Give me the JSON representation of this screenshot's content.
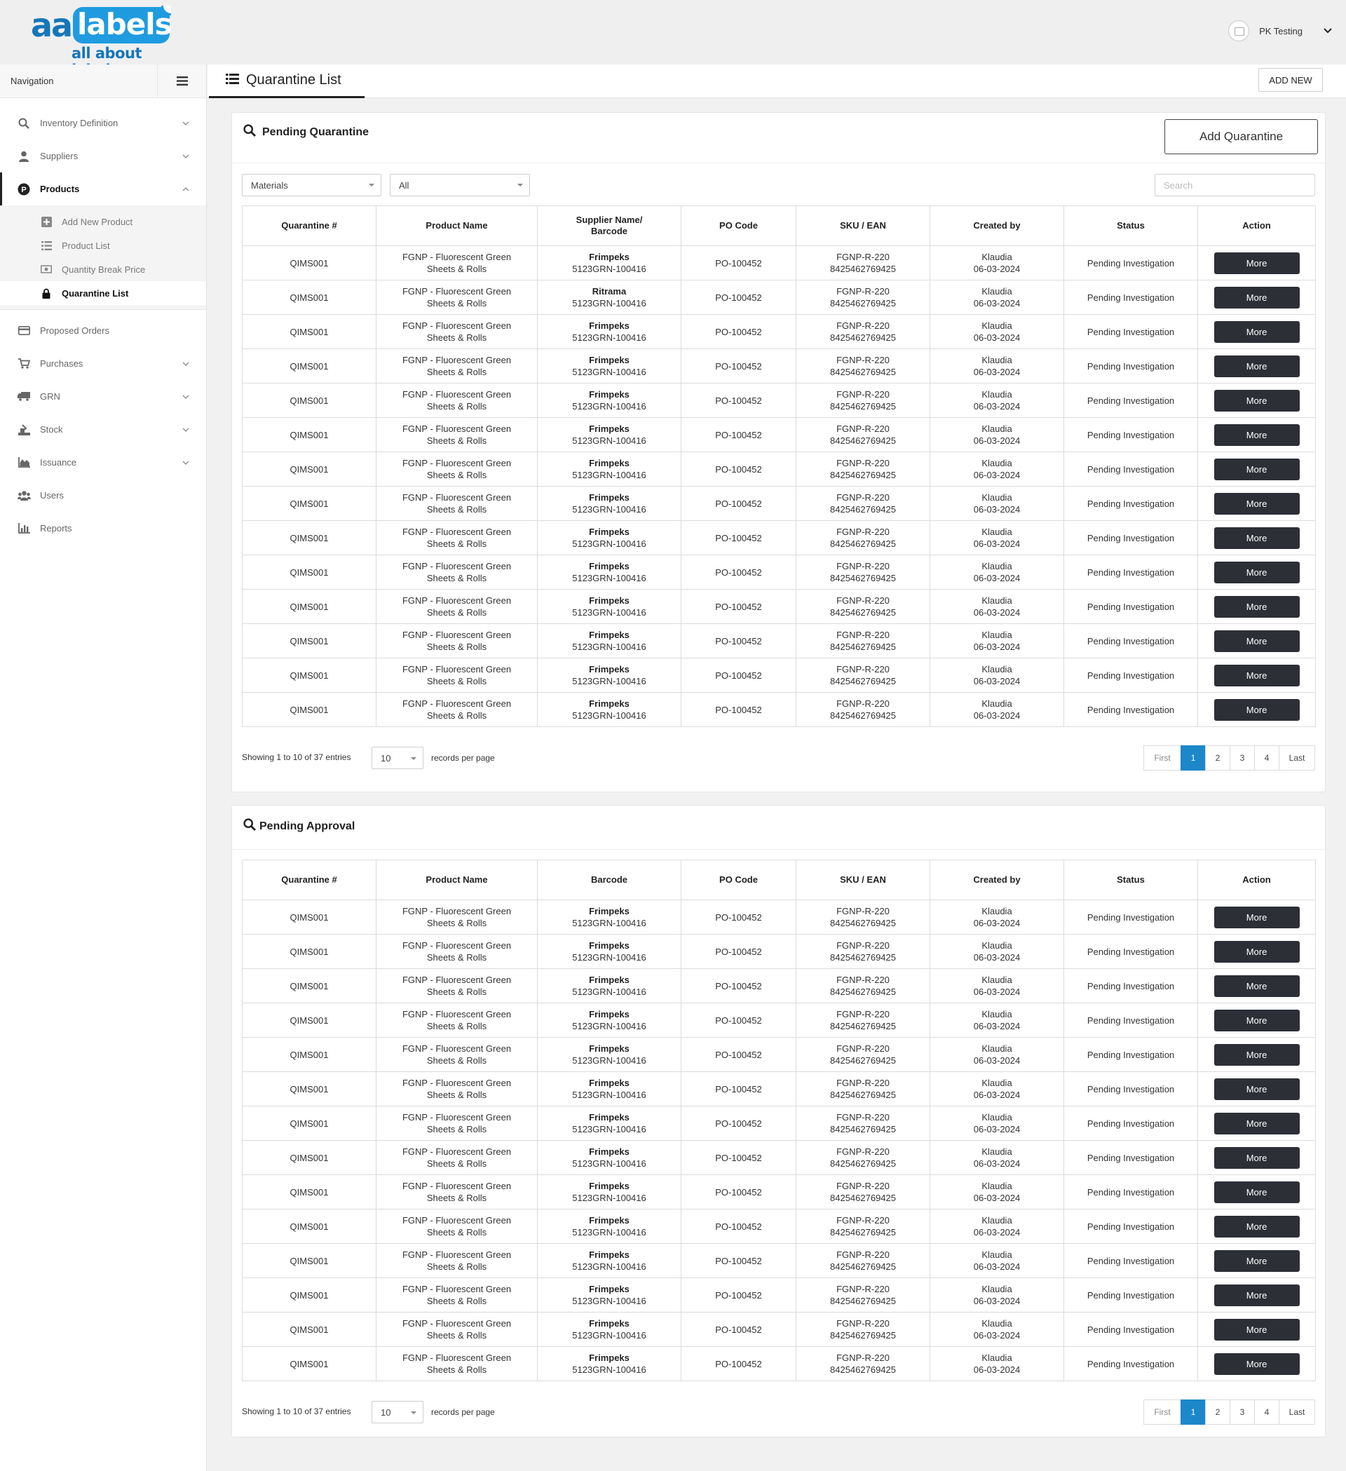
{
  "brand": {
    "logo_aa": "aa",
    "logo_labels": "labels",
    "logo_tagline": "all about labels"
  },
  "user": {
    "name": "PK Testing"
  },
  "sidebar": {
    "header": "Navigation",
    "items": [
      {
        "label": "Inventory Definition",
        "icon": "search-icon",
        "chevron": "down"
      },
      {
        "label": "Suppliers",
        "icon": "user-icon",
        "chevron": "down"
      },
      {
        "label": "Products",
        "icon": "products-p-icon",
        "chevron": "up",
        "active": true
      },
      {
        "label": "Proposed Orders",
        "icon": "card-icon"
      },
      {
        "label": "Purchases",
        "icon": "cart-icon",
        "chevron": "down"
      },
      {
        "label": "GRN",
        "icon": "truck-icon",
        "chevron": "down"
      },
      {
        "label": "Stock",
        "icon": "stock-icon",
        "chevron": "down"
      },
      {
        "label": "Issuance",
        "icon": "area-chart-icon",
        "chevron": "down"
      },
      {
        "label": "Users",
        "icon": "users-icon"
      },
      {
        "label": "Reports",
        "icon": "bar-chart-icon"
      }
    ],
    "product_subitems": [
      {
        "label": "Add New Product",
        "icon": "plus-square-icon"
      },
      {
        "label": "Product List",
        "icon": "list-icon"
      },
      {
        "label": "Quantity Break Price",
        "icon": "money-icon"
      },
      {
        "label": "Quarantine List",
        "icon": "lock-icon",
        "current": true
      }
    ]
  },
  "page": {
    "title": "Quarantine List",
    "add_new": "ADD NEW"
  },
  "pending_quarantine": {
    "title": "Pending Quarantine",
    "add_button": "Add Quarantine",
    "filter_type": "Materials",
    "filter_scope": "All",
    "search_placeholder": "Search",
    "columns": [
      "Quarantine #",
      "Product Name",
      "Supplier Name/\nBarcode",
      "PO Code",
      "SKU / EAN",
      "Created by",
      "Status",
      "Action"
    ],
    "rows": [
      {
        "id": "QIMS001",
        "product1": "FGNP - Fluorescent Green",
        "product2": "Sheets & Rolls",
        "supplier": "Frimpeks",
        "barcode": "5123GRN-100416",
        "po": "PO-100452",
        "sku": "FGNP-R-220",
        "ean": "8425462769425",
        "creator": "Klaudia",
        "date": "06-03-2024",
        "status": "Pending Investigation",
        "action": "More"
      },
      {
        "id": "QIMS001",
        "product1": "FGNP - Fluorescent Green",
        "product2": "Sheets & Rolls",
        "supplier": "Ritrama",
        "barcode": "5123GRN-100416",
        "po": "PO-100452",
        "sku": "FGNP-R-220",
        "ean": "8425462769425",
        "creator": "Klaudia",
        "date": "06-03-2024",
        "status": "Pending Investigation",
        "action": "More"
      },
      {
        "id": "QIMS001",
        "product1": "FGNP - Fluorescent Green",
        "product2": "Sheets & Rolls",
        "supplier": "Frimpeks",
        "barcode": "5123GRN-100416",
        "po": "PO-100452",
        "sku": "FGNP-R-220",
        "ean": "8425462769425",
        "creator": "Klaudia",
        "date": "06-03-2024",
        "status": "Pending Investigation",
        "action": "More"
      },
      {
        "id": "QIMS001",
        "product1": "FGNP - Fluorescent Green",
        "product2": "Sheets & Rolls",
        "supplier": "Frimpeks",
        "barcode": "5123GRN-100416",
        "po": "PO-100452",
        "sku": "FGNP-R-220",
        "ean": "8425462769425",
        "creator": "Klaudia",
        "date": "06-03-2024",
        "status": "Pending Investigation",
        "action": "More"
      },
      {
        "id": "QIMS001",
        "product1": "FGNP - Fluorescent Green",
        "product2": "Sheets & Rolls",
        "supplier": "Frimpeks",
        "barcode": "5123GRN-100416",
        "po": "PO-100452",
        "sku": "FGNP-R-220",
        "ean": "8425462769425",
        "creator": "Klaudia",
        "date": "06-03-2024",
        "status": "Pending Investigation",
        "action": "More"
      },
      {
        "id": "QIMS001",
        "product1": "FGNP - Fluorescent Green",
        "product2": "Sheets & Rolls",
        "supplier": "Frimpeks",
        "barcode": "5123GRN-100416",
        "po": "PO-100452",
        "sku": "FGNP-R-220",
        "ean": "8425462769425",
        "creator": "Klaudia",
        "date": "06-03-2024",
        "status": "Pending Investigation",
        "action": "More"
      },
      {
        "id": "QIMS001",
        "product1": "FGNP - Fluorescent Green",
        "product2": "Sheets & Rolls",
        "supplier": "Frimpeks",
        "barcode": "5123GRN-100416",
        "po": "PO-100452",
        "sku": "FGNP-R-220",
        "ean": "8425462769425",
        "creator": "Klaudia",
        "date": "06-03-2024",
        "status": "Pending Investigation",
        "action": "More"
      },
      {
        "id": "QIMS001",
        "product1": "FGNP - Fluorescent Green",
        "product2": "Sheets & Rolls",
        "supplier": "Frimpeks",
        "barcode": "5123GRN-100416",
        "po": "PO-100452",
        "sku": "FGNP-R-220",
        "ean": "8425462769425",
        "creator": "Klaudia",
        "date": "06-03-2024",
        "status": "Pending Investigation",
        "action": "More"
      },
      {
        "id": "QIMS001",
        "product1": "FGNP - Fluorescent Green",
        "product2": "Sheets & Rolls",
        "supplier": "Frimpeks",
        "barcode": "5123GRN-100416",
        "po": "PO-100452",
        "sku": "FGNP-R-220",
        "ean": "8425462769425",
        "creator": "Klaudia",
        "date": "06-03-2024",
        "status": "Pending Investigation",
        "action": "More"
      },
      {
        "id": "QIMS001",
        "product1": "FGNP - Fluorescent Green",
        "product2": "Sheets & Rolls",
        "supplier": "Frimpeks",
        "barcode": "5123GRN-100416",
        "po": "PO-100452",
        "sku": "FGNP-R-220",
        "ean": "8425462769425",
        "creator": "Klaudia",
        "date": "06-03-2024",
        "status": "Pending Investigation",
        "action": "More"
      },
      {
        "id": "QIMS001",
        "product1": "FGNP - Fluorescent Green",
        "product2": "Sheets & Rolls",
        "supplier": "Frimpeks",
        "barcode": "5123GRN-100416",
        "po": "PO-100452",
        "sku": "FGNP-R-220",
        "ean": "8425462769425",
        "creator": "Klaudia",
        "date": "06-03-2024",
        "status": "Pending Investigation",
        "action": "More"
      },
      {
        "id": "QIMS001",
        "product1": "FGNP - Fluorescent Green",
        "product2": "Sheets & Rolls",
        "supplier": "Frimpeks",
        "barcode": "5123GRN-100416",
        "po": "PO-100452",
        "sku": "FGNP-R-220",
        "ean": "8425462769425",
        "creator": "Klaudia",
        "date": "06-03-2024",
        "status": "Pending Investigation",
        "action": "More"
      },
      {
        "id": "QIMS001",
        "product1": "FGNP - Fluorescent Green",
        "product2": "Sheets & Rolls",
        "supplier": "Frimpeks",
        "barcode": "5123GRN-100416",
        "po": "PO-100452",
        "sku": "FGNP-R-220",
        "ean": "8425462769425",
        "creator": "Klaudia",
        "date": "06-03-2024",
        "status": "Pending Investigation",
        "action": "More"
      },
      {
        "id": "QIMS001",
        "product1": "FGNP - Fluorescent Green",
        "product2": "Sheets & Rolls",
        "supplier": "Frimpeks",
        "barcode": "5123GRN-100416",
        "po": "PO-100452",
        "sku": "FGNP-R-220",
        "ean": "8425462769425",
        "creator": "Klaudia",
        "date": "06-03-2024",
        "status": "Pending Investigation",
        "action": "More"
      }
    ],
    "showing": "Showing 1 to 10 of 37 entries",
    "per_page": "10",
    "records_label": "records per page",
    "pager": {
      "first": "First",
      "pages": [
        "1",
        "2",
        "3",
        "4"
      ],
      "current": "1",
      "last": "Last"
    }
  },
  "pending_approval": {
    "title": "Pending Approval",
    "columns": [
      "Quarantine #",
      "Product Name",
      "Barcode",
      "PO Code",
      "SKU / EAN",
      "Created by",
      "Status",
      "Action"
    ],
    "rows": [
      {
        "id": "QIMS001",
        "product1": "FGNP - Fluorescent Green",
        "product2": "Sheets & Rolls",
        "supplier": "Frimpeks",
        "barcode": "5123GRN-100416",
        "po": "PO-100452",
        "sku": "FGNP-R-220",
        "ean": "8425462769425",
        "creator": "Klaudia",
        "date": "06-03-2024",
        "status": "Pending Investigation",
        "action": "More"
      },
      {
        "id": "QIMS001",
        "product1": "FGNP - Fluorescent Green",
        "product2": "Sheets & Rolls",
        "supplier": "Frimpeks",
        "barcode": "5123GRN-100416",
        "po": "PO-100452",
        "sku": "FGNP-R-220",
        "ean": "8425462769425",
        "creator": "Klaudia",
        "date": "06-03-2024",
        "status": "Pending Investigation",
        "action": "More"
      },
      {
        "id": "QIMS001",
        "product1": "FGNP - Fluorescent Green",
        "product2": "Sheets & Rolls",
        "supplier": "Frimpeks",
        "barcode": "5123GRN-100416",
        "po": "PO-100452",
        "sku": "FGNP-R-220",
        "ean": "8425462769425",
        "creator": "Klaudia",
        "date": "06-03-2024",
        "status": "Pending Investigation",
        "action": "More"
      },
      {
        "id": "QIMS001",
        "product1": "FGNP - Fluorescent Green",
        "product2": "Sheets & Rolls",
        "supplier": "Frimpeks",
        "barcode": "5123GRN-100416",
        "po": "PO-100452",
        "sku": "FGNP-R-220",
        "ean": "8425462769425",
        "creator": "Klaudia",
        "date": "06-03-2024",
        "status": "Pending Investigation",
        "action": "More"
      },
      {
        "id": "QIMS001",
        "product1": "FGNP - Fluorescent Green",
        "product2": "Sheets & Rolls",
        "supplier": "Frimpeks",
        "barcode": "5123GRN-100416",
        "po": "PO-100452",
        "sku": "FGNP-R-220",
        "ean": "8425462769425",
        "creator": "Klaudia",
        "date": "06-03-2024",
        "status": "Pending Investigation",
        "action": "More"
      },
      {
        "id": "QIMS001",
        "product1": "FGNP - Fluorescent Green",
        "product2": "Sheets & Rolls",
        "supplier": "Frimpeks",
        "barcode": "5123GRN-100416",
        "po": "PO-100452",
        "sku": "FGNP-R-220",
        "ean": "8425462769425",
        "creator": "Klaudia",
        "date": "06-03-2024",
        "status": "Pending Investigation",
        "action": "More"
      },
      {
        "id": "QIMS001",
        "product1": "FGNP - Fluorescent Green",
        "product2": "Sheets & Rolls",
        "supplier": "Frimpeks",
        "barcode": "5123GRN-100416",
        "po": "PO-100452",
        "sku": "FGNP-R-220",
        "ean": "8425462769425",
        "creator": "Klaudia",
        "date": "06-03-2024",
        "status": "Pending Investigation",
        "action": "More"
      },
      {
        "id": "QIMS001",
        "product1": "FGNP - Fluorescent Green",
        "product2": "Sheets & Rolls",
        "supplier": "Frimpeks",
        "barcode": "5123GRN-100416",
        "po": "PO-100452",
        "sku": "FGNP-R-220",
        "ean": "8425462769425",
        "creator": "Klaudia",
        "date": "06-03-2024",
        "status": "Pending Investigation",
        "action": "More"
      },
      {
        "id": "QIMS001",
        "product1": "FGNP - Fluorescent Green",
        "product2": "Sheets & Rolls",
        "supplier": "Frimpeks",
        "barcode": "5123GRN-100416",
        "po": "PO-100452",
        "sku": "FGNP-R-220",
        "ean": "8425462769425",
        "creator": "Klaudia",
        "date": "06-03-2024",
        "status": "Pending Investigation",
        "action": "More"
      },
      {
        "id": "QIMS001",
        "product1": "FGNP - Fluorescent Green",
        "product2": "Sheets & Rolls",
        "supplier": "Frimpeks",
        "barcode": "5123GRN-100416",
        "po": "PO-100452",
        "sku": "FGNP-R-220",
        "ean": "8425462769425",
        "creator": "Klaudia",
        "date": "06-03-2024",
        "status": "Pending Investigation",
        "action": "More"
      },
      {
        "id": "QIMS001",
        "product1": "FGNP - Fluorescent Green",
        "product2": "Sheets & Rolls",
        "supplier": "Frimpeks",
        "barcode": "5123GRN-100416",
        "po": "PO-100452",
        "sku": "FGNP-R-220",
        "ean": "8425462769425",
        "creator": "Klaudia",
        "date": "06-03-2024",
        "status": "Pending Investigation",
        "action": "More"
      },
      {
        "id": "QIMS001",
        "product1": "FGNP - Fluorescent Green",
        "product2": "Sheets & Rolls",
        "supplier": "Frimpeks",
        "barcode": "5123GRN-100416",
        "po": "PO-100452",
        "sku": "FGNP-R-220",
        "ean": "8425462769425",
        "creator": "Klaudia",
        "date": "06-03-2024",
        "status": "Pending Investigation",
        "action": "More"
      },
      {
        "id": "QIMS001",
        "product1": "FGNP - Fluorescent Green",
        "product2": "Sheets & Rolls",
        "supplier": "Frimpeks",
        "barcode": "5123GRN-100416",
        "po": "PO-100452",
        "sku": "FGNP-R-220",
        "ean": "8425462769425",
        "creator": "Klaudia",
        "date": "06-03-2024",
        "status": "Pending Investigation",
        "action": "More"
      },
      {
        "id": "QIMS001",
        "product1": "FGNP - Fluorescent Green",
        "product2": "Sheets & Rolls",
        "supplier": "Frimpeks",
        "barcode": "5123GRN-100416",
        "po": "PO-100452",
        "sku": "FGNP-R-220",
        "ean": "8425462769425",
        "creator": "Klaudia",
        "date": "06-03-2024",
        "status": "Pending Investigation",
        "action": "More"
      }
    ],
    "showing": "Showing 1 to 10 of 37 entries",
    "per_page": "10",
    "records_label": "records per page",
    "pager": {
      "first": "First",
      "pages": [
        "1",
        "2",
        "3",
        "4"
      ],
      "current": "1",
      "last": "Last"
    }
  },
  "colors": {
    "accent": "#1c87c9",
    "button_dark": "#2c2f36",
    "logo_blue": "#1f9be0",
    "logo_dark_blue": "#1676b8"
  }
}
